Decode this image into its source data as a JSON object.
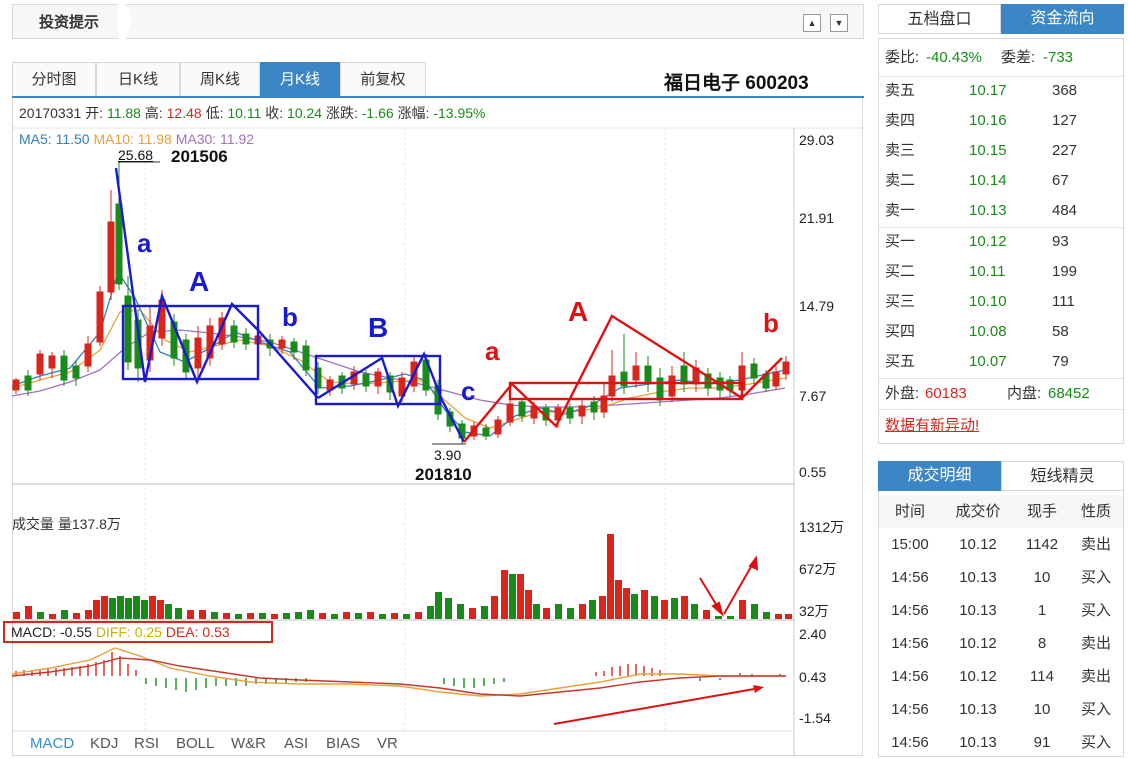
{
  "header": {
    "title": "投资提示",
    "btn_up": "▲",
    "btn_down": "▼"
  },
  "tabs": [
    {
      "label": "分时图",
      "active": false
    },
    {
      "label": "日K线",
      "active": false
    },
    {
      "label": "周K线",
      "active": false
    },
    {
      "label": "月K线",
      "active": true
    },
    {
      "label": "前复权",
      "active": false
    }
  ],
  "stock": {
    "name_code": "福日电子 600203"
  },
  "info": {
    "date": "20170331",
    "open_label": "开:",
    "open": "11.88",
    "high_label": "高:",
    "high": "12.48",
    "low_label": "低:",
    "low": "10.11",
    "close_label": "收:",
    "close": "10.24",
    "change_label": "涨跌:",
    "change": "-1.66",
    "pct_label": "涨幅:",
    "pct": "-13.95%"
  },
  "ma": {
    "ma5": "MA5: 11.50",
    "ma10": "MA10: 11.98",
    "ma30": "MA30: 11.92"
  },
  "price_axis": [
    "29.03",
    "21.91",
    "14.79",
    "7.67",
    "0.55"
  ],
  "annotations": {
    "high_value": "25.68",
    "high_date": "201506",
    "low_value": "3.90",
    "low_date": "201810",
    "blue_labels": [
      "a",
      "A",
      "b",
      "B",
      "c"
    ],
    "red_labels": [
      "a",
      "A",
      "b"
    ]
  },
  "volume": {
    "label": "成交量 量137.8万",
    "axis": [
      "1312万",
      "672万",
      "32万"
    ]
  },
  "macd": {
    "macd_text": "MACD: -0.55",
    "diff_text": "DIFF: 0.25",
    "dea_text": "DEA: 0.53",
    "axis": [
      "2.40",
      "0.43",
      "-1.54"
    ]
  },
  "indicators": [
    "MACD",
    "KDJ",
    "RSI",
    "BOLL",
    "W&R",
    "ASI",
    "BIAS",
    "VR"
  ],
  "quote_tabs": [
    "五档盘口",
    "资金流向"
  ],
  "quote": {
    "weibi_label": "委比:",
    "weibi": "-40.43%",
    "weicha_label": "委差:",
    "weicha": "-733",
    "asks": [
      {
        "label": "卖五",
        "price": "10.17",
        "vol": "368"
      },
      {
        "label": "卖四",
        "price": "10.16",
        "vol": "127"
      },
      {
        "label": "卖三",
        "price": "10.15",
        "vol": "227"
      },
      {
        "label": "卖二",
        "price": "10.14",
        "vol": "67"
      },
      {
        "label": "卖一",
        "price": "10.13",
        "vol": "484"
      }
    ],
    "bids": [
      {
        "label": "买一",
        "price": "10.12",
        "vol": "93"
      },
      {
        "label": "买二",
        "price": "10.11",
        "vol": "199"
      },
      {
        "label": "买三",
        "price": "10.10",
        "vol": "111"
      },
      {
        "label": "买四",
        "price": "10.08",
        "vol": "58"
      },
      {
        "label": "买五",
        "price": "10.07",
        "vol": "79"
      }
    ],
    "outer_label": "外盘:",
    "outer": "60183",
    "inner_label": "内盘:",
    "inner": "68452",
    "alert_link": "数据有新异动!"
  },
  "trade_tabs": [
    "成交明细",
    "短线精灵"
  ],
  "trades": {
    "headers": [
      "时间",
      "成交价",
      "现手",
      "性质"
    ],
    "rows": [
      {
        "time": "15:00",
        "price": "10.12",
        "vol": "1142",
        "type": "卖出"
      },
      {
        "time": "14:56",
        "price": "10.13",
        "vol": "10",
        "type": "买入"
      },
      {
        "time": "14:56",
        "price": "10.13",
        "vol": "1",
        "type": "买入"
      },
      {
        "time": "14:56",
        "price": "10.12",
        "vol": "8",
        "type": "卖出"
      },
      {
        "time": "14:56",
        "price": "10.12",
        "vol": "114",
        "type": "卖出"
      },
      {
        "time": "14:56",
        "price": "10.13",
        "vol": "10",
        "type": "买入"
      },
      {
        "time": "14:56",
        "price": "10.13",
        "vol": "91",
        "type": "买入"
      }
    ]
  },
  "colors": {
    "accent": "#3d86c6",
    "up": "#d8261c",
    "down": "#1a8a1a",
    "ma5": "#2f7fc1",
    "ma10": "#e8a03c",
    "ma30": "#a070c0",
    "wave_blue": "#1a1ad0",
    "wave_red": "#e01010"
  }
}
